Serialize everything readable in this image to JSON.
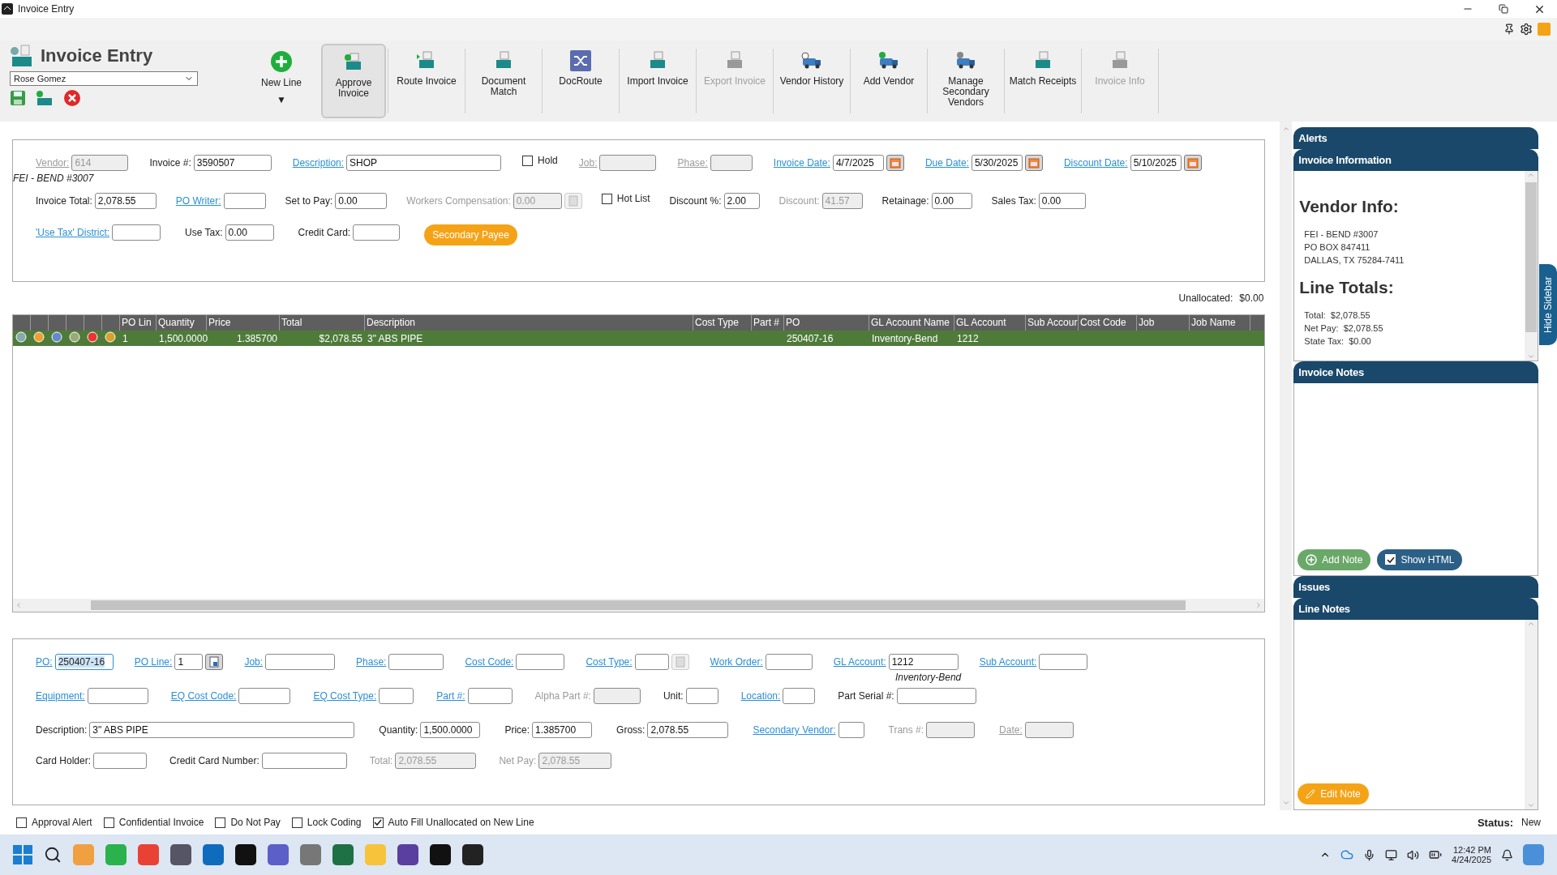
{
  "window": {
    "title": "Invoice Entry"
  },
  "header": {
    "title": "Invoice Entry",
    "user": "Rose Gomez"
  },
  "toolbar": [
    {
      "label": "New Line",
      "disabled": false,
      "selected": false,
      "menu": "▼"
    },
    {
      "label": "Approve Invoice",
      "disabled": false,
      "selected": true
    },
    {
      "label": "Route Invoice",
      "disabled": false,
      "selected": false
    },
    {
      "label": "Document Match",
      "disabled": false,
      "selected": false
    },
    {
      "label": "DocRoute",
      "disabled": false,
      "selected": false
    },
    {
      "label": "Import Invoice",
      "disabled": false,
      "selected": false
    },
    {
      "label": "Export Invoice",
      "disabled": true,
      "selected": false
    },
    {
      "label": "Vendor History",
      "disabled": false,
      "selected": false
    },
    {
      "label": "Add Vendor",
      "disabled": false,
      "selected": false
    },
    {
      "label": "Manage Secondary Vendors",
      "disabled": false,
      "selected": false
    },
    {
      "label": "Match Receipts",
      "disabled": false,
      "selected": false
    },
    {
      "label": "Invoice Info",
      "disabled": true,
      "selected": false
    }
  ],
  "invoice_form": [
    [
      {
        "kind": "text",
        "label": "Vendor:",
        "link": true,
        "disabled": true,
        "value": "614",
        "note": "FEI - BEND #3007"
      },
      {
        "kind": "text",
        "label": "Invoice #:",
        "link": false,
        "disabled": false,
        "value": "3590507"
      },
      {
        "kind": "text",
        "label": "Description:",
        "link": true,
        "disabled": false,
        "value": "SHOP"
      },
      {
        "kind": "check",
        "label": "Hold",
        "checked": false
      },
      {
        "kind": "text",
        "label": "Job:",
        "link": true,
        "disabled": true
      },
      {
        "kind": "text",
        "label": "Phase:",
        "link": true,
        "disabled": true
      },
      {
        "kind": "date",
        "label": "Invoice Date:",
        "link": true,
        "disabled": false,
        "value": "4/7/2025"
      },
      {
        "kind": "date",
        "label": "Due Date:",
        "link": true,
        "disabled": false,
        "value": "5/30/2025"
      },
      {
        "kind": "date",
        "label": "Discount Date:",
        "link": true,
        "disabled": false,
        "value": "5/10/2025"
      }
    ],
    [
      {
        "kind": "text",
        "label": "Invoice Total:",
        "link": false,
        "disabled": false,
        "value": "2,078.55"
      },
      {
        "kind": "text",
        "label": "PO Writer:",
        "link": true,
        "disabled": false
      },
      {
        "kind": "text",
        "label": "Set to Pay:",
        "link": false,
        "disabled": false,
        "value": "0.00"
      },
      {
        "kind": "lookup",
        "label": "Workers Compensation:",
        "link": false,
        "disabled": true,
        "value": "0.00"
      },
      {
        "kind": "check",
        "label": "Hot List",
        "checked": false
      },
      {
        "kind": "text",
        "label": "Discount %:",
        "link": false,
        "disabled": false,
        "value": "2.00"
      },
      {
        "kind": "text",
        "label": "Discount:",
        "link": false,
        "disabled": true,
        "value": "41.57"
      },
      {
        "kind": "text",
        "label": "Retainage:",
        "link": false,
        "disabled": false,
        "value": "0.00"
      },
      {
        "kind": "text",
        "label": "Sales Tax:",
        "link": false,
        "disabled": false,
        "value": "0.00"
      }
    ],
    [
      {
        "kind": "text",
        "label": "'Use Tax' District:",
        "link": true,
        "disabled": false
      },
      {
        "kind": "text",
        "label": "Use Tax:",
        "link": false,
        "disabled": false,
        "value": "0.00"
      },
      {
        "kind": "text",
        "label": "Credit Card:",
        "link": false,
        "disabled": false
      },
      {
        "kind": "button",
        "label": "Secondary Payee"
      }
    ]
  ],
  "unallocated": {
    "label": "Unallocated:",
    "value": "$0.00"
  },
  "table": {
    "columns": [
      "PO Lin",
      "Quantity",
      "Price",
      "Total",
      "Description",
      "Cost Type",
      "Part #",
      "PO",
      "GL Account Name",
      "GL Account",
      "Sub Accour",
      "Cost Code",
      "Job",
      "Job Name"
    ],
    "rows": [
      {
        "selected": true,
        "cells": [
          "1",
          "1,500.0000",
          "1.385700",
          "$2,078.55",
          "3\" ABS PIPE",
          null,
          null,
          "250407-16",
          "Inventory-Bend",
          "1212",
          null,
          null,
          null,
          null
        ]
      }
    ]
  },
  "line_form": [
    [
      {
        "kind": "text",
        "label": "PO:",
        "link": true,
        "disabled": false,
        "value": "250407-16",
        "focused": true
      },
      {
        "kind": "lookup",
        "label": "PO Line:",
        "link": true,
        "disabled": false,
        "value": "1"
      },
      {
        "kind": "text",
        "label": "Job:",
        "link": true,
        "disabled": false
      },
      {
        "kind": "text",
        "label": "Phase:",
        "link": true,
        "disabled": false
      },
      {
        "kind": "text",
        "label": "Cost Code:",
        "link": true,
        "disabled": false
      },
      {
        "kind": "lookup",
        "label": "Cost Type:",
        "link": true,
        "disabled": false,
        "lookup_disabled": true
      },
      {
        "kind": "text",
        "label": "Work Order:",
        "link": true,
        "disabled": false
      },
      {
        "kind": "text",
        "label": "GL Account:",
        "link": true,
        "disabled": false,
        "value": "1212",
        "note": "Inventory-Bend"
      },
      {
        "kind": "text",
        "label": "Sub Account:",
        "link": true,
        "disabled": false
      }
    ],
    [
      {
        "kind": "text",
        "label": "Equipment:",
        "link": true,
        "disabled": false
      },
      {
        "kind": "text",
        "label": "EQ Cost Code:",
        "link": true,
        "disabled": false
      },
      {
        "kind": "text",
        "label": "EQ Cost Type:",
        "link": true,
        "disabled": false
      },
      {
        "kind": "text",
        "label": "Part #:",
        "link": true,
        "disabled": false
      },
      {
        "kind": "text",
        "label": "Alpha Part #:",
        "link": false,
        "disabled": true
      },
      {
        "kind": "text",
        "label": "Unit:",
        "link": false,
        "disabled": false
      },
      {
        "kind": "text",
        "label": "Location:",
        "link": true,
        "disabled": false
      },
      {
        "kind": "text",
        "label": "Part Serial #:",
        "link": false,
        "disabled": false
      }
    ],
    [
      {
        "kind": "text",
        "label": "Description:",
        "link": false,
        "disabled": false,
        "value": "3\" ABS PIPE"
      },
      {
        "kind": "text",
        "label": "Quantity:",
        "link": false,
        "disabled": false,
        "value": "1,500.0000"
      },
      {
        "kind": "text",
        "label": "Price:",
        "link": false,
        "disabled": false,
        "value": "1.385700"
      },
      {
        "kind": "text",
        "label": "Gross:",
        "link": false,
        "disabled": false,
        "value": "2,078.55"
      },
      {
        "kind": "text",
        "label": "Secondary Vendor:",
        "link": true,
        "disabled": false
      },
      {
        "kind": "text",
        "label": "Trans #:",
        "link": false,
        "disabled": true
      },
      {
        "kind": "text",
        "label": "Date:",
        "link": true,
        "disabled": true
      }
    ],
    [
      {
        "kind": "text",
        "label": "Card Holder:",
        "link": false,
        "disabled": false
      },
      {
        "kind": "text",
        "label": "Credit Card Number:",
        "link": false,
        "disabled": false
      },
      {
        "kind": "text",
        "label": "Total:",
        "link": false,
        "disabled": true,
        "value": "2,078.55"
      },
      {
        "kind": "text",
        "label": "Net Pay:",
        "link": false,
        "disabled": true,
        "value": "2,078.55"
      }
    ]
  ],
  "footer": {
    "options": [
      {
        "label": "Approval Alert",
        "checked": false
      },
      {
        "label": "Confidential Invoice",
        "checked": false
      },
      {
        "label": "Do Not Pay",
        "checked": false
      },
      {
        "label": "Lock Coding",
        "checked": false
      },
      {
        "label": "Auto Fill Unallocated on New Line",
        "checked": true
      }
    ],
    "status_label": "Status:",
    "status": "New"
  },
  "sidebar": {
    "toggle": "Hide Sidebar",
    "alerts": "Alerts",
    "info": {
      "title": "Invoice Information",
      "vendor_heading": "Vendor Info:",
      "vendor_lines": [
        "FEI - BEND #3007",
        "PO BOX 847411",
        "DALLAS, TX 75284-7411"
      ],
      "totals_heading": "Line Totals:",
      "totals": [
        {
          "label": "Total:",
          "value": "$2,078.55"
        },
        {
          "label": "Net Pay:",
          "value": "$2,078.55"
        },
        {
          "label": "State Tax:",
          "value": "$0.00"
        }
      ]
    },
    "notes": {
      "title": "Invoice Notes",
      "add": "Add Note",
      "html": {
        "label": "Show HTML",
        "checked": true
      }
    },
    "issues": "Issues",
    "line_notes": {
      "title": "Line Notes",
      "edit": "Edit Note"
    }
  },
  "taskbar": {
    "time": "12:42 PM",
    "date": "4/24/2025"
  }
}
